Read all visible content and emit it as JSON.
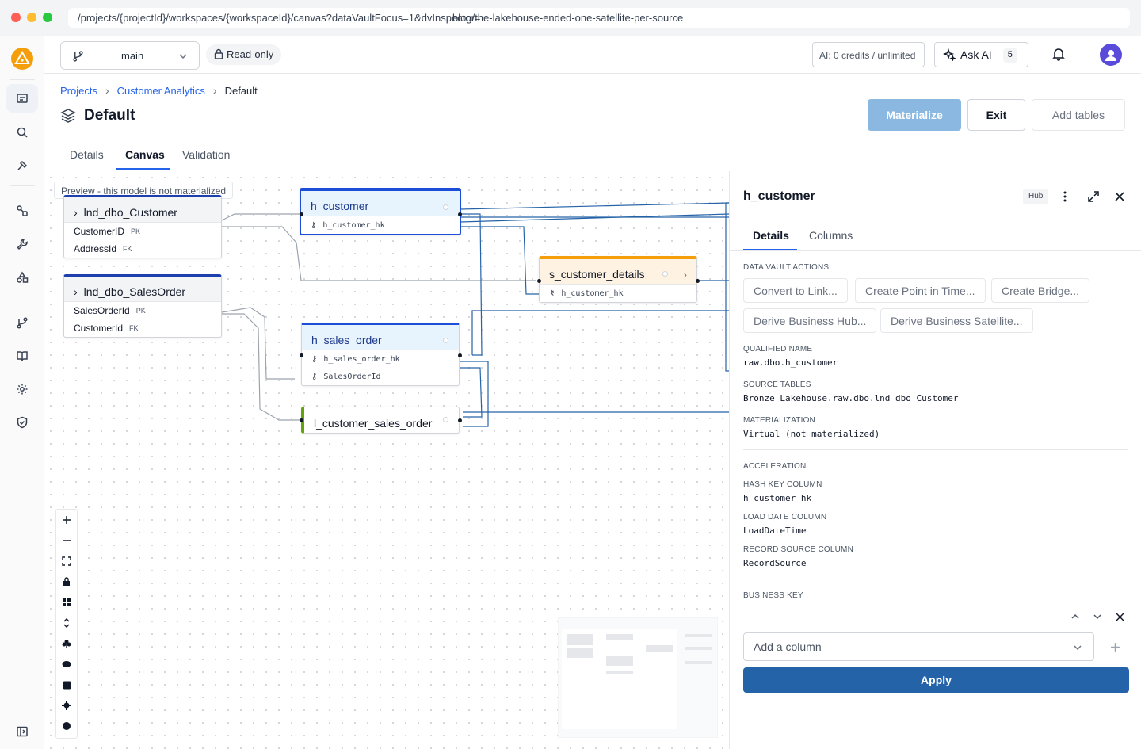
{
  "browser": {
    "url_a": "/projects/{projectId}/workspaces/{workspaceId}/canvas?dataVaultFocus=1&dvInspector=",
    "url_b": "blog/the-lakehouse-ended-one-satellite-per-source"
  },
  "topbar": {
    "branch": "main",
    "readonly": "Read-only",
    "credits": "AI: 0 credits / unlimited",
    "ask_ai": "Ask AI",
    "ask_ai_count": "5"
  },
  "breadcrumb": [
    "Projects",
    "Customer Analytics",
    "Default"
  ],
  "page_title": "Default",
  "actions": {
    "materialize": "Materialize",
    "exit": "Exit",
    "add_tables": "Add tables"
  },
  "tabs": [
    "Details",
    "Canvas",
    "Validation"
  ],
  "canvas": {
    "preview_note": "Preview - this model is not materialized",
    "nodes": {
      "src_customer": {
        "title": "lnd_dbo_Customer",
        "rows": [
          {
            "name": "CustomerID",
            "tag": "PK"
          },
          {
            "name": "AddressId",
            "tag": "FK"
          }
        ]
      },
      "src_salesorder": {
        "title": "lnd_dbo_SalesOrder",
        "rows": [
          {
            "name": "SalesOrderId",
            "tag": "PK"
          },
          {
            "name": "CustomerId",
            "tag": "FK"
          }
        ]
      },
      "h_customer": {
        "title": "h_customer",
        "key": "h_customer_hk"
      },
      "s_customer_details": {
        "title": "s_customer_details",
        "key": "h_customer_hk"
      },
      "h_sales_order": {
        "title": "h_sales_order",
        "keys": [
          "h_sales_order_hk",
          "SalesOrderId"
        ]
      },
      "l_customer_sales_order": {
        "title": "l_customer_sales_order"
      }
    }
  },
  "panel": {
    "title": "h_customer",
    "badge": "Hub",
    "tabs": [
      "Details",
      "Columns"
    ],
    "dv_actions_label": "DATA VAULT ACTIONS",
    "dv_actions": [
      "Convert to Link...",
      "Create Point in Time...",
      "Create Bridge...",
      "Derive Business Hub...",
      "Derive Business Satellite..."
    ],
    "qualified_name_label": "QUALIFIED NAME",
    "qualified_name": "raw.dbo.h_customer",
    "source_tables_label": "SOURCE TABLES",
    "source_tables": "Bronze Lakehouse.raw.dbo.lnd_dbo_Customer",
    "materialization_label": "MATERIALIZATION",
    "materialization": "Virtual (not materialized)",
    "acceleration_label": "ACCELERATION",
    "hash_key_label": "HASH KEY COLUMN",
    "hash_key": "h_customer_hk",
    "load_date_label": "LOAD DATE COLUMN",
    "load_date": "LoadDateTime",
    "record_source_label": "RECORD SOURCE COLUMN",
    "record_source": "RecordSource",
    "business_key_label": "BUSINESS KEY",
    "add_column_placeholder": "Add a column",
    "apply": "Apply"
  }
}
